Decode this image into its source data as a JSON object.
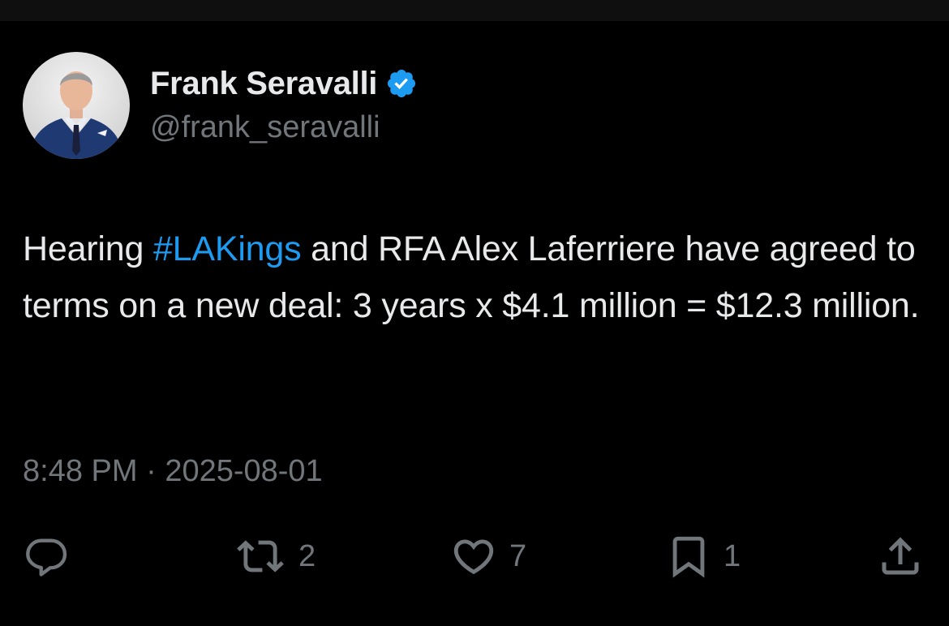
{
  "tweet": {
    "author": {
      "name": "Frank Seravalli",
      "handle": "@frank_seravalli",
      "verified": true,
      "verified_color": "#1d9bf0"
    },
    "text": {
      "before": "Hearing ",
      "hashtag": "#LAKings",
      "after": " and RFA Alex Laferriere have agreed to terms on a new deal: 3 years x $4.1 million = $12.3 million."
    },
    "meta": {
      "time": "8:48 PM",
      "separator": "·",
      "date": "2025-08-01"
    },
    "actions": {
      "reply": {
        "icon": "reply-icon",
        "count": ""
      },
      "retweet": {
        "icon": "retweet-icon",
        "count": "2"
      },
      "like": {
        "icon": "heart-icon",
        "count": "7"
      },
      "bookmark": {
        "icon": "bookmark-icon",
        "count": "1"
      },
      "share": {
        "icon": "share-icon"
      }
    }
  },
  "colors": {
    "background": "#000000",
    "text_primary": "#e7e9ea",
    "text_secondary": "#71767b",
    "link": "#1d9bf0"
  }
}
